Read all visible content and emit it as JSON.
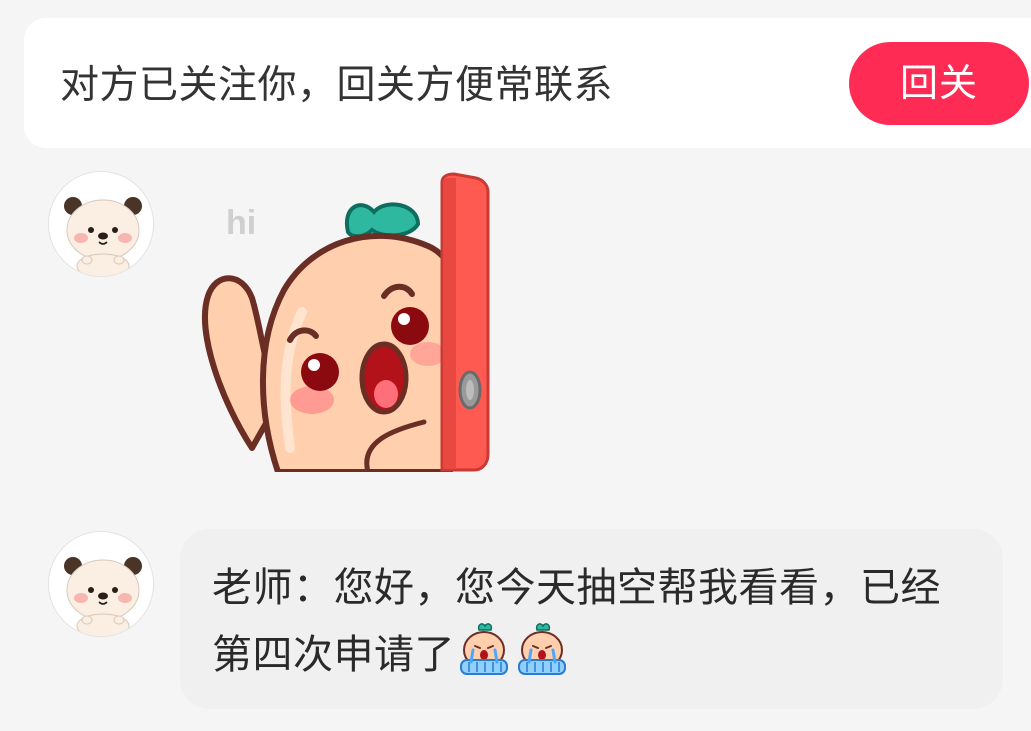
{
  "follow_banner": {
    "text": "对方已关注你，回关方便常联系",
    "button_label": "回关"
  },
  "messages": [
    {
      "type": "sticker",
      "sticker_text": "hi",
      "avatar_icon": "bear-avatar-icon"
    },
    {
      "type": "text",
      "text": "老师：您好，您今天抽空帮我看看，已经第四次申请了",
      "trailing_emojis": [
        "crying-peach-emoji",
        "crying-peach-emoji"
      ],
      "avatar_icon": "bear-avatar-icon"
    }
  ],
  "colors": {
    "accent": "#fe2c55",
    "bubble_bg": "#f0f0f0",
    "page_bg": "#f5f5f5"
  }
}
